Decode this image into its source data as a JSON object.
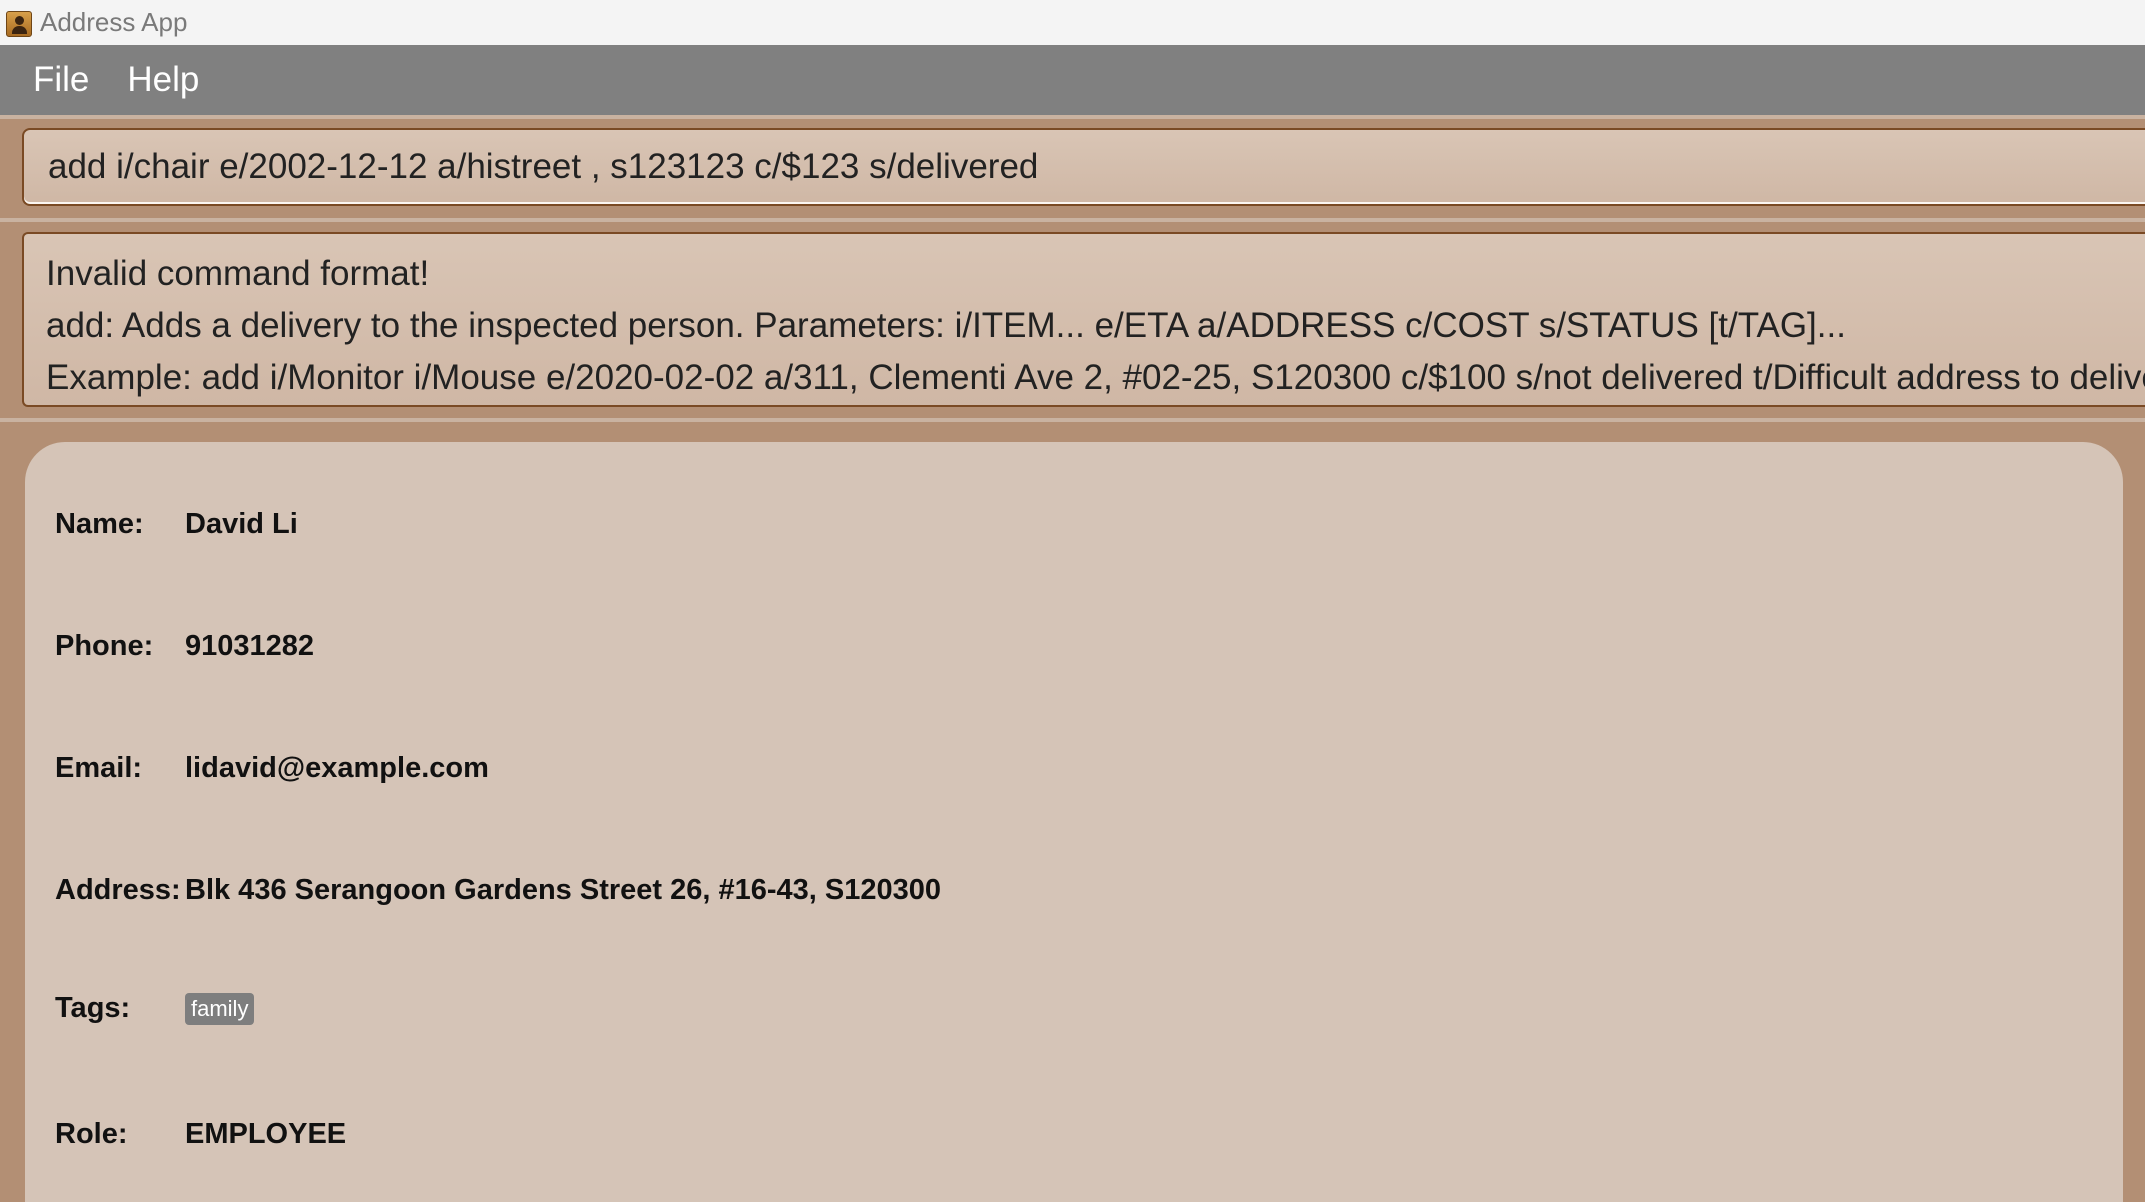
{
  "window": {
    "title": "Address App"
  },
  "menu": {
    "items": [
      "File",
      "Help"
    ]
  },
  "command": {
    "value": "add i/chair e/2002-12-12 a/histreet , s123123 c/$123 s/delivered"
  },
  "result": {
    "lines": [
      "Invalid command format!",
      "add: Adds a delivery to the inspected person. Parameters: i/ITEM... e/ETA a/ADDRESS c/COST s/STATUS [t/TAG]...",
      "Example: add i/Monitor i/Mouse e/2020-02-02 a/311, Clementi Ave 2, #02-25, S120300 c/$100 s/not delivered t/Difficult address to deliver t/Best b"
    ]
  },
  "person": {
    "name_label": "Name:",
    "name": "David Li",
    "phone_label": "Phone:",
    "phone": "91031282",
    "email_label": "Email:",
    "email": "lidavid@example.com",
    "address_label": "Address:",
    "address": "Blk 436 Serangoon Gardens Street 26, #16-43, S120300",
    "tags_label": "Tags:",
    "tags": [
      "family"
    ],
    "role_label": "Role:",
    "role": "EMPLOYEE"
  },
  "colors": {
    "background": "#b38f74",
    "menubar": "#808080",
    "card": "#d5c4b7",
    "tag": "#7e7e7e",
    "border": "#7a4a24"
  }
}
